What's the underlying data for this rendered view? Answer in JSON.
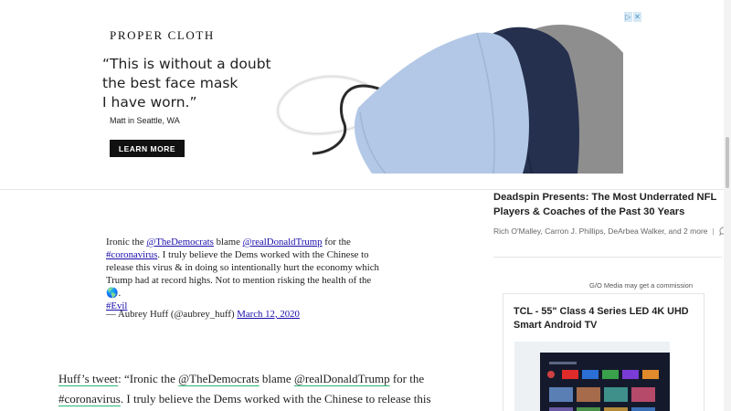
{
  "ad": {
    "badge": [
      "▷",
      "✕"
    ],
    "brand": "PROPER CLOTH",
    "quote": "“This is without a doubt\nthe best face mask\nI have worn.”",
    "author": "Matt in Seattle, WA",
    "cta": "LEARN MORE",
    "mask_colors": [
      "#b3c8e6",
      "#25304e",
      "#8e8e8e"
    ]
  },
  "tweet": {
    "prefix": "Ironic the ",
    "mention1": "@TheDemocrats",
    "mid1": " blame ",
    "mention2": "@realDonaldTrump",
    "mid2": " for the ",
    "hashtag1": "#coronavirus",
    "rest": ". I truly believe the Dems worked with the Chinese to release this virus & in doing so intentionally hurt the economy which Trump had at record highs. Not to mention risking the health of the ",
    "emoji": "🌎",
    "after_emoji": ".",
    "hashtag2": "#Evil",
    "byline": "— Aubrey Huff (@aubrey_huff) ",
    "date": "March 12, 2020"
  },
  "body": {
    "link": "Huff’s tweet",
    "t1": ": “Ironic the ",
    "m1": "@TheDemocrats",
    "t2": " blame ",
    "m2": "@realDonaldTrump",
    "t3": " for the ",
    "h1": "#coronavirus",
    "t4": ". I truly believe the Dems worked with the Chinese to release this"
  },
  "sidebar": {
    "article_title": "Deadspin Presents: The Most Underrated NFL Players & Coaches of the Past 30 Years",
    "authors": "Rich O'Malley, Carron J. Phillips, DeArbea Walker, and 2 more",
    "separator": "|",
    "commission": "G/O Media may get a commission",
    "product_title": "TCL - 55\" Class 4 Series LED 4K UHD Smart Android TV"
  }
}
